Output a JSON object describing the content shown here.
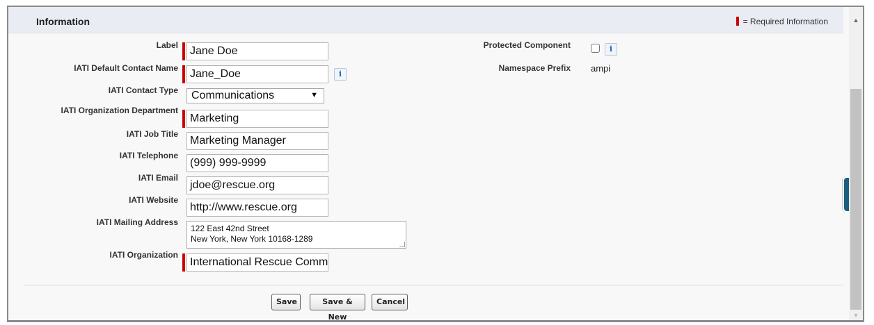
{
  "section": {
    "title": "Information",
    "required_legend": "= Required Information"
  },
  "fields": {
    "label": {
      "label": "Label",
      "value": "Jane Doe"
    },
    "contact_name": {
      "label": "IATI Default Contact Name",
      "value": "Jane_Doe"
    },
    "contact_type": {
      "label": "IATI Contact Type",
      "value": "Communications"
    },
    "org_department": {
      "label": "IATI Organization Department",
      "value": "Marketing"
    },
    "job_title": {
      "label": "IATI Job Title",
      "value": "Marketing Manager"
    },
    "telephone": {
      "label": "IATI Telephone",
      "value": "(999) 999-9999"
    },
    "email": {
      "label": "IATI Email",
      "value": "jdoe@rescue.org"
    },
    "website": {
      "label": "IATI Website",
      "value": "http://www.rescue.org"
    },
    "mailing_address": {
      "label": "IATI Mailing Address",
      "line1": "122 East 42nd Street",
      "line2": "New York, New York 10168-1289"
    },
    "organization": {
      "label": "IATI Organization",
      "value": "International Rescue Comm"
    },
    "protected_component": {
      "label": "Protected Component",
      "checked": false
    },
    "namespace_prefix": {
      "label": "Namespace Prefix",
      "value": "ampi"
    }
  },
  "buttons": {
    "save": "Save",
    "save_new": "Save & New",
    "cancel": "Cancel"
  },
  "icons": {
    "info": "i",
    "select_caret": "▼",
    "scroll_up": "▲",
    "scroll_down": "▼"
  },
  "colors": {
    "required": "#cc0000",
    "header_bg": "#e9ecf2",
    "side_tab": "#1b5f7e",
    "info_icon": "#1f5fbf"
  }
}
